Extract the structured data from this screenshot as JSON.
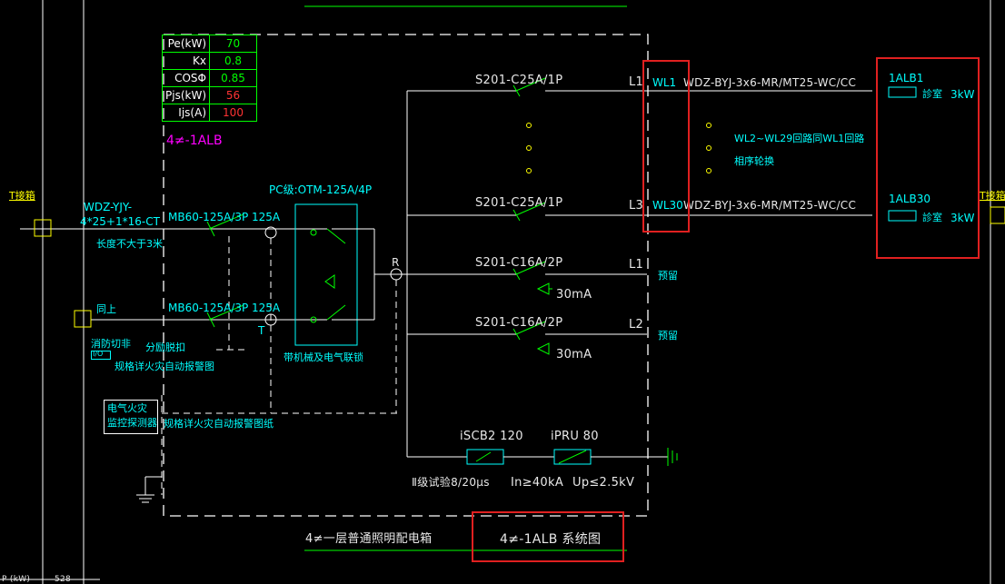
{
  "params": [
    {
      "key": "Pe(kW)",
      "value": "70",
      "color": "#00ff00"
    },
    {
      "key": "Kx",
      "value": "0.8",
      "color": "#00ff00"
    },
    {
      "key": "COSΦ",
      "value": "0.85",
      "color": "#00ff00"
    },
    {
      "key": "Pjs(kW)",
      "value": "56",
      "color": "#ff3333"
    },
    {
      "key": "Ijs(A)",
      "value": "100",
      "color": "#ff3333"
    }
  ],
  "panel_id": "4≠-1ALB",
  "incoming": {
    "cable": "WDZ-YJY-",
    "cable_spec": "4*25+1*16-CT",
    "length_note": "长度不大于3米",
    "t_box_left": "T接箱",
    "same_above": "同上",
    "fire_switch": "消防切非",
    "io_label": "I/O",
    "shunt_trip": "分励脱扣",
    "fire_alarm_note": "规格详火灾自动报警图",
    "monitor_label_1": "电气火灾",
    "monitor_label_2": "监控探测器",
    "monitor_note": "规格详火灾自动报警图纸",
    "breaker1": "MB60-125A/3P 125A",
    "breaker2": "MB60-125A/3P 125A",
    "t_mark": "T"
  },
  "pc": {
    "label": "PC级:OTM-125A/4P",
    "note": "带机械及电气联锁",
    "bus_r": "R"
  },
  "circuits": [
    {
      "breaker": "S201-C25A/1P",
      "phase": "L1",
      "wl": "WL1",
      "cable": "WDZ-BYJ-3x6-MR/MT25-WC/CC",
      "load": "1ALB1",
      "room": "診室",
      "power": "3kW"
    },
    {
      "breaker": "S201-C25A/1P",
      "phase": "L3",
      "wl": "WL30",
      "cable": "WDZ-BYJ-3x6-MR/MT25-WC/CC",
      "load": "1ALB30",
      "room": "診室",
      "power": "3kW"
    },
    {
      "breaker": "S201-C16A/2P",
      "phase": "L1",
      "rcd": "30mA",
      "spare": "预留"
    },
    {
      "breaker": "S201-C16A/2P",
      "phase": "L2",
      "rcd": "30mA",
      "spare": "预留"
    }
  ],
  "wl_note_1": "WL2~WL29回路同WL1回路",
  "wl_note_2": "相序轮换",
  "t_box_right": "T接箱",
  "spd": {
    "iscb": "iSCB2 120",
    "ipru": "iPRU 80",
    "class": "Ⅱ级试验8/20μs",
    "in": "In≥40kA",
    "up": "Up≤2.5kV"
  },
  "footer": {
    "title_left": "4≠一层普通照明配电箱",
    "title_right": "4≠-1ALB 系统图"
  },
  "status": {
    "left_fragment": "P (kW)",
    "right_fragment": "528"
  },
  "colors": {
    "background": "#000000",
    "wire": "#ffffff",
    "cyan": "#00ffff",
    "green": "#00ff00",
    "yellow": "#ffff00",
    "magenta": "#ff00ff",
    "highlight": "#e02020"
  }
}
